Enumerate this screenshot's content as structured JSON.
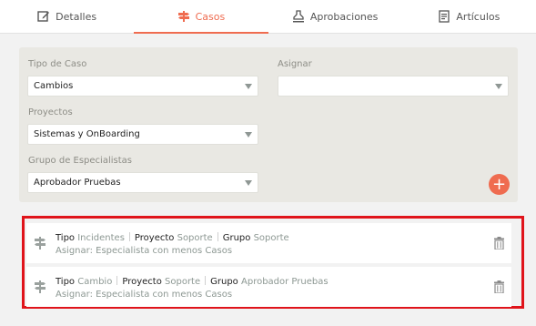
{
  "tabs": [
    {
      "label": "Detalles",
      "icon": "edit-icon",
      "active": false
    },
    {
      "label": "Casos",
      "icon": "signpost-icon",
      "active": true
    },
    {
      "label": "Aprobaciones",
      "icon": "stamp-icon",
      "active": false
    },
    {
      "label": "Artículos",
      "icon": "document-icon",
      "active": false
    }
  ],
  "form": {
    "tipo_caso": {
      "label": "Tipo de Caso",
      "value": "Cambios"
    },
    "asignar": {
      "label": "Asignar",
      "value": ""
    },
    "proyectos": {
      "label": "Proyectos",
      "value": "Sistemas y OnBoarding"
    },
    "grupo": {
      "label": "Grupo de Especialistas",
      "value": "Aprobador Pruebas"
    },
    "add_label": "+"
  },
  "cases": [
    {
      "tipo_key": "Tipo",
      "tipo": "Incidentes",
      "proyecto_key": "Proyecto",
      "proyecto": "Soporte",
      "grupo_key": "Grupo",
      "grupo": "Soporte",
      "asignar": "Asignar: Especialista con menos Casos"
    },
    {
      "tipo_key": "Tipo",
      "tipo": "Cambio",
      "proyecto_key": "Proyecto",
      "proyecto": "Soporte",
      "grupo_key": "Grupo",
      "grupo": "Aprobador Pruebas",
      "asignar": "Asignar: Especialista con menos Casos"
    }
  ],
  "colors": {
    "accent": "#ef6c50",
    "highlight": "#e0141b",
    "panel": "#e9e8e3"
  }
}
